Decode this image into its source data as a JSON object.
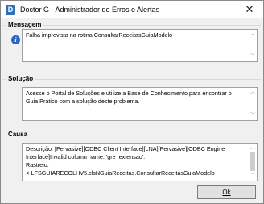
{
  "window": {
    "title": "Doctor G - Administrador de Erros e Alertas"
  },
  "mensagem": {
    "label": "Mensagem",
    "text": "Falha imprevista na rotina ConsultarReceitasGuiaModelo"
  },
  "solucao": {
    "label": "Solução",
    "text": "Acesse o Portal de Soluções e utilize a Base de Conhecimento para encontrar o Guia Prático com a solução deste problema."
  },
  "causa": {
    "label": "Causa",
    "line1": "Descrição: [Pervasive][ODBC Client Interface][LNA][Pervasive][ODBC Engine Interface]Invalid column name: 'gre_extensao'.",
    "line2": "Rastreio:",
    "line3": "<-LFSGUIARECOLHV5.clsNGuiaReceitas.ConsultarReceitasGuiaModelo"
  },
  "buttons": {
    "ok_label": "Ok"
  },
  "icons": {
    "app": "doctor-g-app-icon",
    "info": "info-icon",
    "close": "close-icon"
  }
}
